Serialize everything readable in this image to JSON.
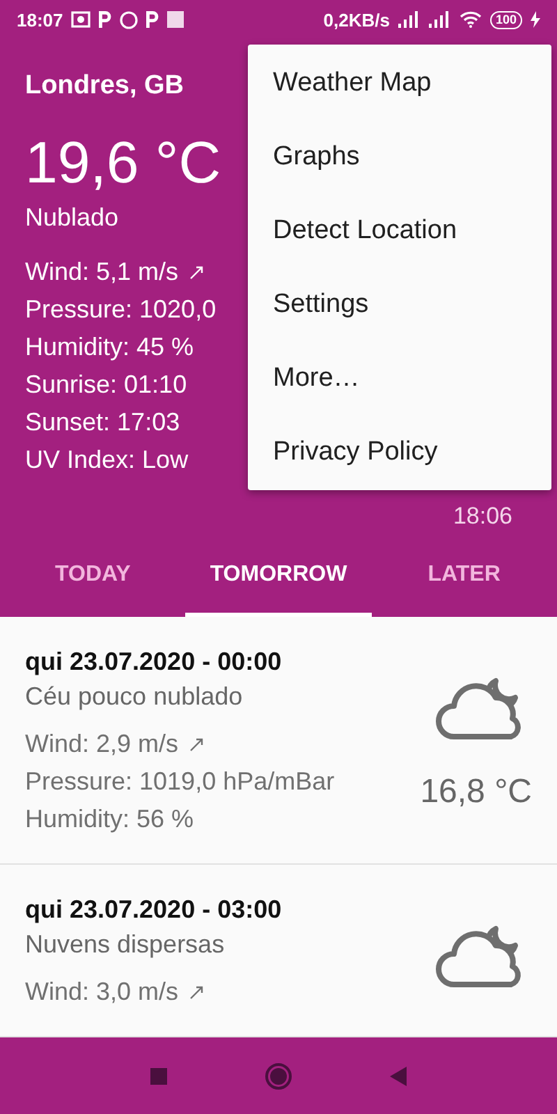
{
  "status_bar": {
    "time": "18:07",
    "network_speed": "0,2KB/s",
    "battery": "100"
  },
  "location": "Londres, GB",
  "temperature": "19,6 °C",
  "condition": "Nublado",
  "details": [
    {
      "kind": "wind",
      "text": "Wind: 5,1 m/s"
    },
    {
      "kind": "plain",
      "text": "Pressure: 1020,0"
    },
    {
      "kind": "plain",
      "text": "Humidity: 45 %"
    },
    {
      "kind": "plain",
      "text": "Sunrise: 01:10"
    },
    {
      "kind": "plain",
      "text": "Sunset: 17:03"
    },
    {
      "kind": "plain",
      "text": "UV Index: Low"
    }
  ],
  "updated_time": "18:06",
  "tabs": [
    {
      "label": "TODAY",
      "selected": false
    },
    {
      "label": "TOMORROW",
      "selected": true
    },
    {
      "label": "LATER",
      "selected": false
    }
  ],
  "forecast": [
    {
      "datetime": "qui 23.07.2020 - 00:00",
      "description": "Céu pouco nublado",
      "details": [
        {
          "kind": "wind",
          "text": "Wind: 2,9 m/s"
        },
        {
          "kind": "plain",
          "text": "Pressure: 1019,0 hPa/mBar"
        },
        {
          "kind": "plain",
          "text": "Humidity: 56 %"
        }
      ],
      "temperature": "16,8 °C"
    },
    {
      "datetime": "qui 23.07.2020 - 03:00",
      "description": "Nuvens dispersas",
      "details": [
        {
          "kind": "wind",
          "text": "Wind: 3,0 m/s"
        }
      ]
    }
  ],
  "menu": [
    "Weather Map",
    "Graphs",
    "Detect Location",
    "Settings",
    "More…",
    "Privacy Policy"
  ]
}
